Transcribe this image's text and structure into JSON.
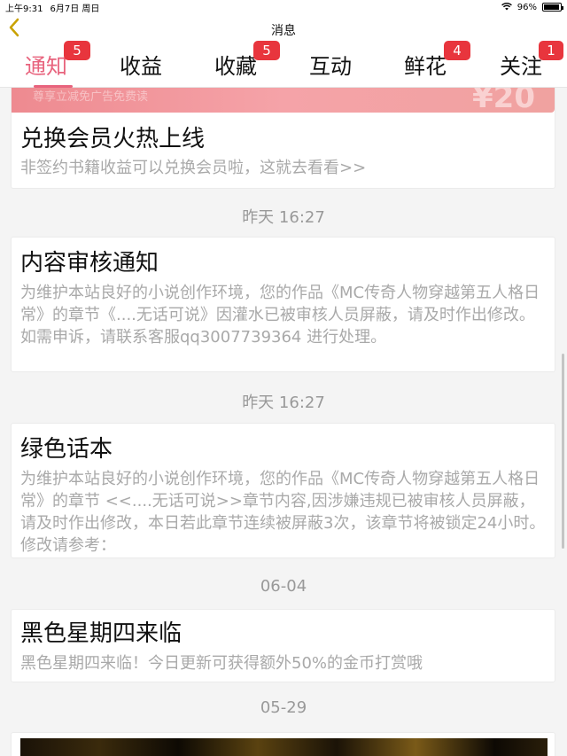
{
  "status_bar": {
    "time": "上午9:31",
    "date": "6月7日 周日",
    "battery": "96%",
    "battery_level": 0.96
  },
  "nav": {
    "title": "消息",
    "back_icon": "chevron-left-icon"
  },
  "tabs": [
    {
      "label": "通知",
      "badge": "5",
      "active": true
    },
    {
      "label": "收益",
      "badge": ""
    },
    {
      "label": "收藏",
      "badge": "5"
    },
    {
      "label": "互动",
      "badge": ""
    },
    {
      "label": "鲜花",
      "badge": "4"
    },
    {
      "label": "关注",
      "badge": "1"
    }
  ],
  "messages": [
    {
      "title": "兑换会员火热上线",
      "body": "非签约书籍收益可以兑换会员啦，这就去看看>>",
      "banner_text": "尊享立减免广告免费读",
      "banner_amount": "¥20"
    },
    {
      "timestamp": "昨天 16:27",
      "title": "内容审核通知",
      "body": "为维护本站良好的小说创作环境，您的作品《MC传奇人物穿越第五人格日常》的章节《....无话可说》因灌水已被审核人员屏蔽，请及时作出修改。如需申诉，请联系客服qq3007739364 进行处理。"
    },
    {
      "timestamp": "昨天 16:27",
      "title": "绿色话本",
      "body": "为维护本站良好的小说创作环境，您的作品《MC传奇人物穿越第五人格日常》的章节 <<....无话可说>>章节内容,因涉嫌违规已被审核人员屏蔽，请及时作出修改，本日若此章节连续被屏蔽3次，该章节将被锁定24小时。修改请参考："
    },
    {
      "timestamp": "06-04",
      "title": "黑色星期四来临",
      "body": "黑色星期四来临！今日更新可获得额外50%的金币打赏哦"
    },
    {
      "timestamp": "05-29"
    }
  ]
}
